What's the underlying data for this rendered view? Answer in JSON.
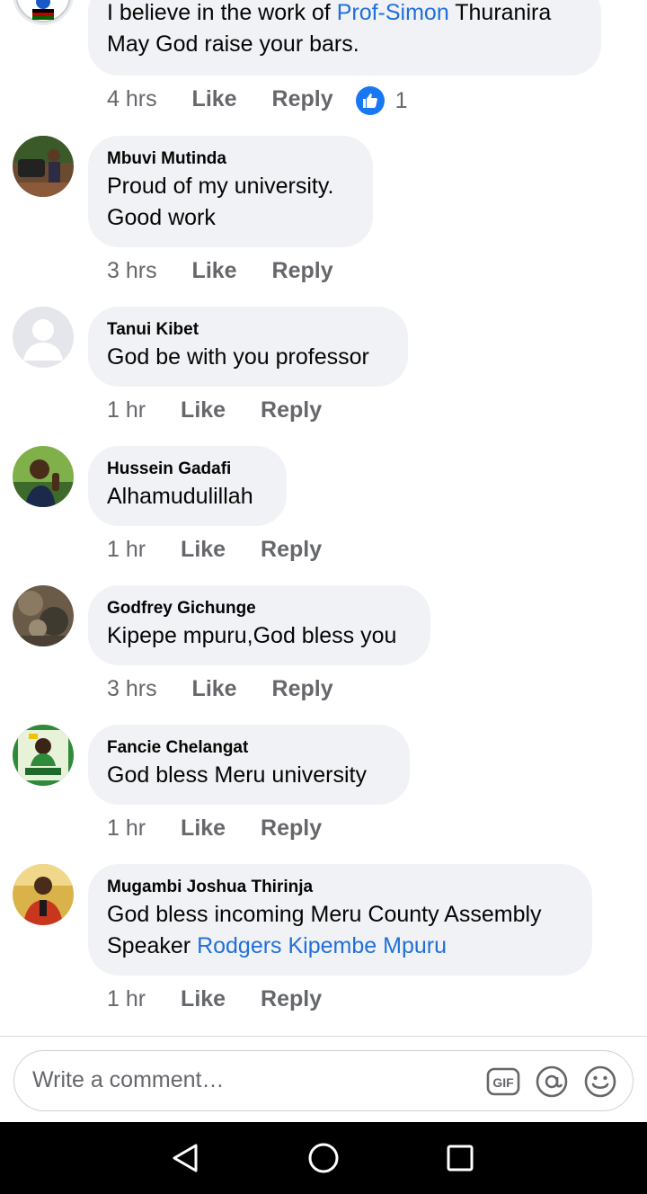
{
  "comments": [
    {
      "author": "",
      "lines": [
        [
          {
            "t": "I believe in the work of "
          },
          {
            "t": "Prof-Simon",
            "link": true
          },
          {
            "t": " Thuranira"
          }
        ],
        [
          {
            "t": "May God raise your bars."
          }
        ]
      ],
      "time": "4 hrs",
      "like_label": "Like",
      "reply_label": "Reply",
      "reaction": {
        "icon": "thumbs-up-icon",
        "count": "1"
      }
    },
    {
      "author": "Mbuvi Mutinda",
      "lines": [
        [
          {
            "t": "Proud of my university."
          }
        ],
        [
          {
            "t": "Good work"
          }
        ]
      ],
      "time": "3 hrs",
      "like_label": "Like",
      "reply_label": "Reply"
    },
    {
      "author": "Tanui Kibet",
      "lines": [
        [
          {
            "t": "God be with you professor"
          }
        ]
      ],
      "time": "1 hr",
      "like_label": "Like",
      "reply_label": "Reply"
    },
    {
      "author": "Hussein Gadafi",
      "lines": [
        [
          {
            "t": "Alhamudulillah"
          }
        ]
      ],
      "time": "1 hr",
      "like_label": "Like",
      "reply_label": "Reply"
    },
    {
      "author": "Godfrey Gichunge",
      "lines": [
        [
          {
            "t": "Kipepe mpuru,God bless you"
          }
        ]
      ],
      "time": "3 hrs",
      "like_label": "Like",
      "reply_label": "Reply"
    },
    {
      "author": "Fancie Chelangat",
      "lines": [
        [
          {
            "t": "God bless  Meru university"
          }
        ]
      ],
      "time": "1 hr",
      "like_label": "Like",
      "reply_label": "Reply"
    },
    {
      "author": "Mugambi Joshua Thirinja",
      "lines": [
        [
          {
            "t": "God bless incoming Meru County Assembly"
          }
        ],
        [
          {
            "t": "Speaker "
          },
          {
            "t": "Rodgers Kipembe Mpuru",
            "link": true
          }
        ]
      ],
      "time": "1 hr",
      "like_label": "Like",
      "reply_label": "Reply"
    }
  ],
  "composer": {
    "placeholder": "Write a comment…",
    "icons": [
      "gif-icon",
      "mention-icon",
      "emoji-icon"
    ],
    "gif_label": "GIF"
  },
  "navbar": {
    "icons": [
      "back-icon",
      "home-icon",
      "recents-icon"
    ]
  },
  "colors": {
    "link": "#216fdb",
    "bubble": "#f0f2f5",
    "meta": "#65676b",
    "like_blue": "#1877f2"
  }
}
